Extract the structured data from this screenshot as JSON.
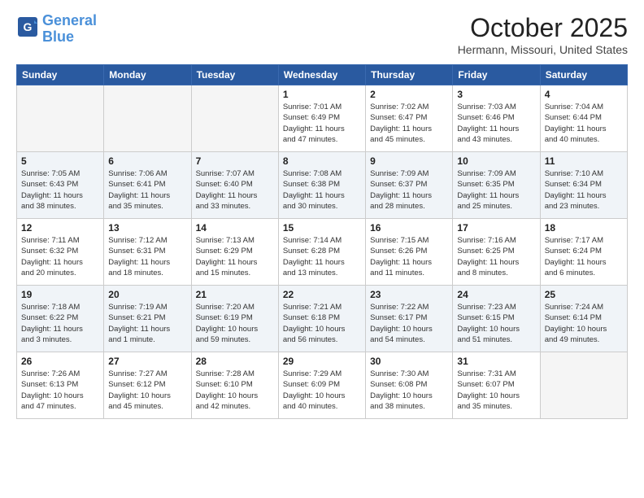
{
  "header": {
    "logo_line1": "General",
    "logo_line2": "Blue",
    "month": "October 2025",
    "location": "Hermann, Missouri, United States"
  },
  "days_of_week": [
    "Sunday",
    "Monday",
    "Tuesday",
    "Wednesday",
    "Thursday",
    "Friday",
    "Saturday"
  ],
  "weeks": [
    [
      {
        "day": "",
        "info": ""
      },
      {
        "day": "",
        "info": ""
      },
      {
        "day": "",
        "info": ""
      },
      {
        "day": "1",
        "info": "Sunrise: 7:01 AM\nSunset: 6:49 PM\nDaylight: 11 hours\nand 47 minutes."
      },
      {
        "day": "2",
        "info": "Sunrise: 7:02 AM\nSunset: 6:47 PM\nDaylight: 11 hours\nand 45 minutes."
      },
      {
        "day": "3",
        "info": "Sunrise: 7:03 AM\nSunset: 6:46 PM\nDaylight: 11 hours\nand 43 minutes."
      },
      {
        "day": "4",
        "info": "Sunrise: 7:04 AM\nSunset: 6:44 PM\nDaylight: 11 hours\nand 40 minutes."
      }
    ],
    [
      {
        "day": "5",
        "info": "Sunrise: 7:05 AM\nSunset: 6:43 PM\nDaylight: 11 hours\nand 38 minutes."
      },
      {
        "day": "6",
        "info": "Sunrise: 7:06 AM\nSunset: 6:41 PM\nDaylight: 11 hours\nand 35 minutes."
      },
      {
        "day": "7",
        "info": "Sunrise: 7:07 AM\nSunset: 6:40 PM\nDaylight: 11 hours\nand 33 minutes."
      },
      {
        "day": "8",
        "info": "Sunrise: 7:08 AM\nSunset: 6:38 PM\nDaylight: 11 hours\nand 30 minutes."
      },
      {
        "day": "9",
        "info": "Sunrise: 7:09 AM\nSunset: 6:37 PM\nDaylight: 11 hours\nand 28 minutes."
      },
      {
        "day": "10",
        "info": "Sunrise: 7:09 AM\nSunset: 6:35 PM\nDaylight: 11 hours\nand 25 minutes."
      },
      {
        "day": "11",
        "info": "Sunrise: 7:10 AM\nSunset: 6:34 PM\nDaylight: 11 hours\nand 23 minutes."
      }
    ],
    [
      {
        "day": "12",
        "info": "Sunrise: 7:11 AM\nSunset: 6:32 PM\nDaylight: 11 hours\nand 20 minutes."
      },
      {
        "day": "13",
        "info": "Sunrise: 7:12 AM\nSunset: 6:31 PM\nDaylight: 11 hours\nand 18 minutes."
      },
      {
        "day": "14",
        "info": "Sunrise: 7:13 AM\nSunset: 6:29 PM\nDaylight: 11 hours\nand 15 minutes."
      },
      {
        "day": "15",
        "info": "Sunrise: 7:14 AM\nSunset: 6:28 PM\nDaylight: 11 hours\nand 13 minutes."
      },
      {
        "day": "16",
        "info": "Sunrise: 7:15 AM\nSunset: 6:26 PM\nDaylight: 11 hours\nand 11 minutes."
      },
      {
        "day": "17",
        "info": "Sunrise: 7:16 AM\nSunset: 6:25 PM\nDaylight: 11 hours\nand 8 minutes."
      },
      {
        "day": "18",
        "info": "Sunrise: 7:17 AM\nSunset: 6:24 PM\nDaylight: 11 hours\nand 6 minutes."
      }
    ],
    [
      {
        "day": "19",
        "info": "Sunrise: 7:18 AM\nSunset: 6:22 PM\nDaylight: 11 hours\nand 3 minutes."
      },
      {
        "day": "20",
        "info": "Sunrise: 7:19 AM\nSunset: 6:21 PM\nDaylight: 11 hours\nand 1 minute."
      },
      {
        "day": "21",
        "info": "Sunrise: 7:20 AM\nSunset: 6:19 PM\nDaylight: 10 hours\nand 59 minutes."
      },
      {
        "day": "22",
        "info": "Sunrise: 7:21 AM\nSunset: 6:18 PM\nDaylight: 10 hours\nand 56 minutes."
      },
      {
        "day": "23",
        "info": "Sunrise: 7:22 AM\nSunset: 6:17 PM\nDaylight: 10 hours\nand 54 minutes."
      },
      {
        "day": "24",
        "info": "Sunrise: 7:23 AM\nSunset: 6:15 PM\nDaylight: 10 hours\nand 51 minutes."
      },
      {
        "day": "25",
        "info": "Sunrise: 7:24 AM\nSunset: 6:14 PM\nDaylight: 10 hours\nand 49 minutes."
      }
    ],
    [
      {
        "day": "26",
        "info": "Sunrise: 7:26 AM\nSunset: 6:13 PM\nDaylight: 10 hours\nand 47 minutes."
      },
      {
        "day": "27",
        "info": "Sunrise: 7:27 AM\nSunset: 6:12 PM\nDaylight: 10 hours\nand 45 minutes."
      },
      {
        "day": "28",
        "info": "Sunrise: 7:28 AM\nSunset: 6:10 PM\nDaylight: 10 hours\nand 42 minutes."
      },
      {
        "day": "29",
        "info": "Sunrise: 7:29 AM\nSunset: 6:09 PM\nDaylight: 10 hours\nand 40 minutes."
      },
      {
        "day": "30",
        "info": "Sunrise: 7:30 AM\nSunset: 6:08 PM\nDaylight: 10 hours\nand 38 minutes."
      },
      {
        "day": "31",
        "info": "Sunrise: 7:31 AM\nSunset: 6:07 PM\nDaylight: 10 hours\nand 35 minutes."
      },
      {
        "day": "",
        "info": ""
      }
    ]
  ]
}
